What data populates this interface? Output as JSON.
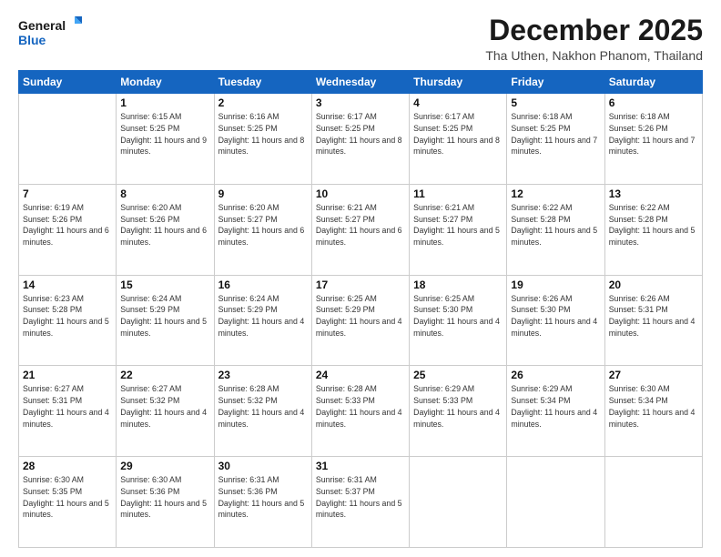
{
  "header": {
    "logo_text_general": "General",
    "logo_text_blue": "Blue",
    "month": "December 2025",
    "location": "Tha Uthen, Nakhon Phanom, Thailand"
  },
  "days_of_week": [
    "Sunday",
    "Monday",
    "Tuesday",
    "Wednesday",
    "Thursday",
    "Friday",
    "Saturday"
  ],
  "weeks": [
    [
      {
        "day": "",
        "info": ""
      },
      {
        "day": "1",
        "info": "Sunrise: 6:15 AM\nSunset: 5:25 PM\nDaylight: 11 hours\nand 9 minutes."
      },
      {
        "day": "2",
        "info": "Sunrise: 6:16 AM\nSunset: 5:25 PM\nDaylight: 11 hours\nand 8 minutes."
      },
      {
        "day": "3",
        "info": "Sunrise: 6:17 AM\nSunset: 5:25 PM\nDaylight: 11 hours\nand 8 minutes."
      },
      {
        "day": "4",
        "info": "Sunrise: 6:17 AM\nSunset: 5:25 PM\nDaylight: 11 hours\nand 8 minutes."
      },
      {
        "day": "5",
        "info": "Sunrise: 6:18 AM\nSunset: 5:25 PM\nDaylight: 11 hours\nand 7 minutes."
      },
      {
        "day": "6",
        "info": "Sunrise: 6:18 AM\nSunset: 5:26 PM\nDaylight: 11 hours\nand 7 minutes."
      }
    ],
    [
      {
        "day": "7",
        "info": "Sunrise: 6:19 AM\nSunset: 5:26 PM\nDaylight: 11 hours\nand 6 minutes."
      },
      {
        "day": "8",
        "info": "Sunrise: 6:20 AM\nSunset: 5:26 PM\nDaylight: 11 hours\nand 6 minutes."
      },
      {
        "day": "9",
        "info": "Sunrise: 6:20 AM\nSunset: 5:27 PM\nDaylight: 11 hours\nand 6 minutes."
      },
      {
        "day": "10",
        "info": "Sunrise: 6:21 AM\nSunset: 5:27 PM\nDaylight: 11 hours\nand 6 minutes."
      },
      {
        "day": "11",
        "info": "Sunrise: 6:21 AM\nSunset: 5:27 PM\nDaylight: 11 hours\nand 5 minutes."
      },
      {
        "day": "12",
        "info": "Sunrise: 6:22 AM\nSunset: 5:28 PM\nDaylight: 11 hours\nand 5 minutes."
      },
      {
        "day": "13",
        "info": "Sunrise: 6:22 AM\nSunset: 5:28 PM\nDaylight: 11 hours\nand 5 minutes."
      }
    ],
    [
      {
        "day": "14",
        "info": "Sunrise: 6:23 AM\nSunset: 5:28 PM\nDaylight: 11 hours\nand 5 minutes."
      },
      {
        "day": "15",
        "info": "Sunrise: 6:24 AM\nSunset: 5:29 PM\nDaylight: 11 hours\nand 5 minutes."
      },
      {
        "day": "16",
        "info": "Sunrise: 6:24 AM\nSunset: 5:29 PM\nDaylight: 11 hours\nand 4 minutes."
      },
      {
        "day": "17",
        "info": "Sunrise: 6:25 AM\nSunset: 5:29 PM\nDaylight: 11 hours\nand 4 minutes."
      },
      {
        "day": "18",
        "info": "Sunrise: 6:25 AM\nSunset: 5:30 PM\nDaylight: 11 hours\nand 4 minutes."
      },
      {
        "day": "19",
        "info": "Sunrise: 6:26 AM\nSunset: 5:30 PM\nDaylight: 11 hours\nand 4 minutes."
      },
      {
        "day": "20",
        "info": "Sunrise: 6:26 AM\nSunset: 5:31 PM\nDaylight: 11 hours\nand 4 minutes."
      }
    ],
    [
      {
        "day": "21",
        "info": "Sunrise: 6:27 AM\nSunset: 5:31 PM\nDaylight: 11 hours\nand 4 minutes."
      },
      {
        "day": "22",
        "info": "Sunrise: 6:27 AM\nSunset: 5:32 PM\nDaylight: 11 hours\nand 4 minutes."
      },
      {
        "day": "23",
        "info": "Sunrise: 6:28 AM\nSunset: 5:32 PM\nDaylight: 11 hours\nand 4 minutes."
      },
      {
        "day": "24",
        "info": "Sunrise: 6:28 AM\nSunset: 5:33 PM\nDaylight: 11 hours\nand 4 minutes."
      },
      {
        "day": "25",
        "info": "Sunrise: 6:29 AM\nSunset: 5:33 PM\nDaylight: 11 hours\nand 4 minutes."
      },
      {
        "day": "26",
        "info": "Sunrise: 6:29 AM\nSunset: 5:34 PM\nDaylight: 11 hours\nand 4 minutes."
      },
      {
        "day": "27",
        "info": "Sunrise: 6:30 AM\nSunset: 5:34 PM\nDaylight: 11 hours\nand 4 minutes."
      }
    ],
    [
      {
        "day": "28",
        "info": "Sunrise: 6:30 AM\nSunset: 5:35 PM\nDaylight: 11 hours\nand 5 minutes."
      },
      {
        "day": "29",
        "info": "Sunrise: 6:30 AM\nSunset: 5:36 PM\nDaylight: 11 hours\nand 5 minutes."
      },
      {
        "day": "30",
        "info": "Sunrise: 6:31 AM\nSunset: 5:36 PM\nDaylight: 11 hours\nand 5 minutes."
      },
      {
        "day": "31",
        "info": "Sunrise: 6:31 AM\nSunset: 5:37 PM\nDaylight: 11 hours\nand 5 minutes."
      },
      {
        "day": "",
        "info": ""
      },
      {
        "day": "",
        "info": ""
      },
      {
        "day": "",
        "info": ""
      }
    ]
  ]
}
